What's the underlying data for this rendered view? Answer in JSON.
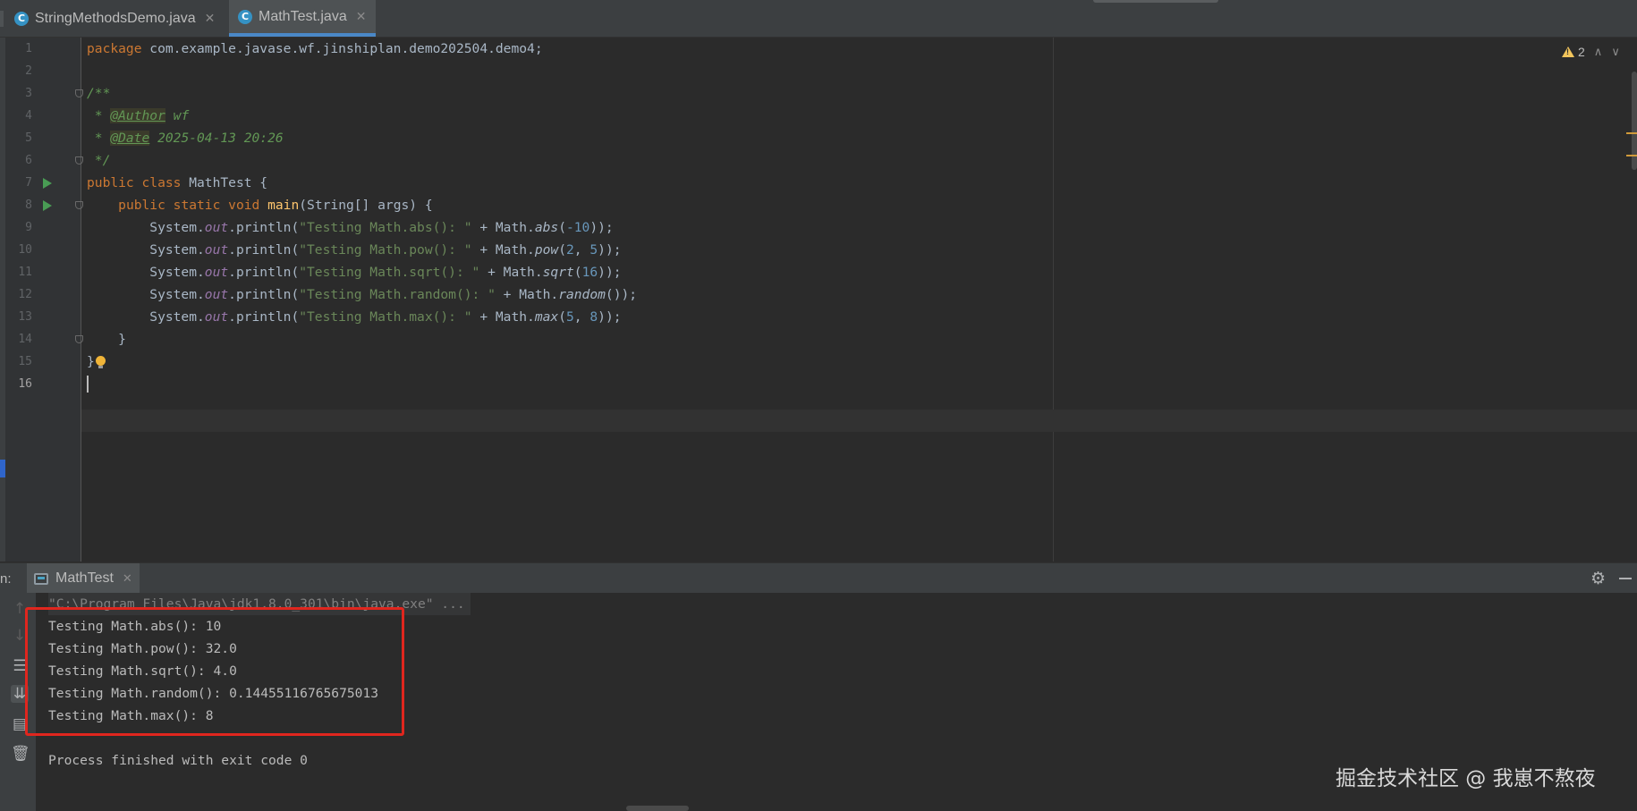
{
  "tabs": [
    {
      "label": "StringMethodsDemo.java",
      "icon": "c",
      "active": false
    },
    {
      "label": "MathTest.java",
      "icon": "c",
      "active": true
    }
  ],
  "editor": {
    "line_numbers": [
      "1",
      "2",
      "3",
      "4",
      "5",
      "6",
      "7",
      "8",
      "9",
      "10",
      "11",
      "12",
      "13",
      "14",
      "15",
      "16"
    ],
    "current_line": "16",
    "warning_count": "2",
    "code": {
      "l1_kw": "package",
      "l1_rest": " com.example.javase.wf.jinshiplan.demo202504.demo4;",
      "l3": "/**",
      "l4_pre": " * ",
      "l4_tag": "@Author",
      "l4_val": " wf",
      "l5_pre": " * ",
      "l5_tag": "@Date",
      "l5_val": " 2025-04-13 20:26",
      "l6": " */",
      "l7_kw": "public class",
      "l7_rest": " MathTest {",
      "l8_indent": "    ",
      "l8_kw": "public static void",
      "l8_fn": "main",
      "l8_rest": "(String[] args) {",
      "prefix": "        System.",
      "out": "out",
      "println": ".println(",
      "concat": " + Math.",
      "l9_str": "\"Testing Math.abs(): \"",
      "l9_fn": "abs",
      "l9_args": "-10",
      "l10_str": "\"Testing Math.pow(): \"",
      "l10_fn": "pow",
      "l10_a1": "2",
      "l10_a2": "5",
      "l11_str": "\"Testing Math.sqrt(): \"",
      "l11_fn": "sqrt",
      "l11_args": "16",
      "l12_str": "\"Testing Math.random(): \"",
      "l12_fn": "random",
      "l13_str": "\"Testing Math.max(): \"",
      "l13_fn": "max",
      "l13_a1": "5",
      "l13_a2": "8",
      "l14": "    }",
      "l15": "}"
    }
  },
  "run_panel": {
    "label": "n:",
    "tab_label": "MathTest",
    "command_line": "\"C:\\Program Files\\Java\\jdk1.8.0_301\\bin\\java.exe\" ...",
    "output": [
      "Testing Math.abs(): 10",
      "Testing Math.pow(): 32.0",
      "Testing Math.sqrt(): 4.0",
      "Testing Math.random(): 0.14455116765675013",
      "Testing Math.max(): 8"
    ],
    "exit_message": "Process finished with exit code 0"
  },
  "watermark": "掘金技术社区 @ 我崽不熬夜",
  "colors": {
    "keyword": "#cc7832",
    "string": "#6a8759",
    "number": "#6897bb",
    "comment": "#629755",
    "highlight_box": "#e0261e"
  }
}
